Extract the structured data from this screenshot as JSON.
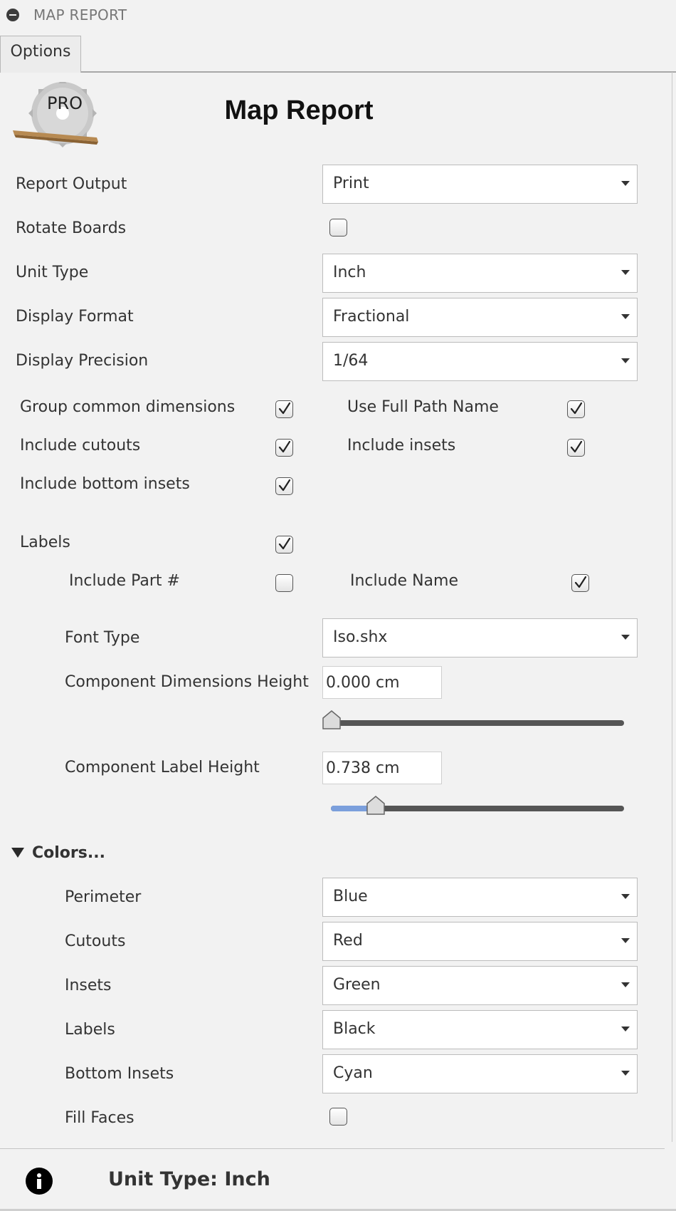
{
  "window": {
    "title": "MAP REPORT"
  },
  "tabs": [
    {
      "label": "Options"
    }
  ],
  "header": {
    "logo_text": "PRO",
    "title": "Map Report"
  },
  "report_output": {
    "label": "Report Output",
    "value": "Print"
  },
  "rotate_boards": {
    "label": "Rotate Boards",
    "checked": false
  },
  "unit_type": {
    "label": "Unit Type",
    "value": "Inch"
  },
  "display_format": {
    "label": "Display Format",
    "value": "Fractional"
  },
  "display_precision": {
    "label": "Display Precision",
    "value": "1/64"
  },
  "options": {
    "group_common_dimensions": {
      "label": "Group common dimensions",
      "checked": true
    },
    "use_full_path_name": {
      "label": "Use Full Path Name",
      "checked": true
    },
    "include_cutouts": {
      "label": "Include cutouts",
      "checked": true
    },
    "include_insets": {
      "label": "Include insets",
      "checked": true
    },
    "include_bottom_insets": {
      "label": "Include bottom insets",
      "checked": true
    }
  },
  "labels_section": {
    "label": "Labels",
    "checked": true,
    "include_part_number": {
      "label": "Include Part #",
      "checked": false
    },
    "include_name": {
      "label": "Include Name",
      "checked": true
    },
    "font_type": {
      "label": "Font Type",
      "value": "Iso.shx"
    },
    "component_dimensions_height": {
      "label": "Component Dimensions Height",
      "value": "0.000 cm",
      "slider_fraction": 0.0
    },
    "component_label_height": {
      "label": "Component Label Height",
      "value": "0.738 cm",
      "slider_fraction": 0.15
    }
  },
  "colors": {
    "header": "Colors...",
    "expanded": true,
    "perimeter": {
      "label": "Perimeter",
      "value": "Blue"
    },
    "cutouts": {
      "label": "Cutouts",
      "value": "Red"
    },
    "insets": {
      "label": "Insets",
      "value": "Green"
    },
    "labels": {
      "label": "Labels",
      "value": "Black"
    },
    "bottom_insets": {
      "label": "Bottom Insets",
      "value": "Cyan"
    },
    "fill_faces": {
      "label": "Fill Faces",
      "checked": false
    }
  },
  "status": {
    "icon": "info-icon",
    "text": "Unit Type: Inch"
  },
  "theme": {
    "slider_fill": "#7b9fdc",
    "slider_track": "#555555"
  }
}
